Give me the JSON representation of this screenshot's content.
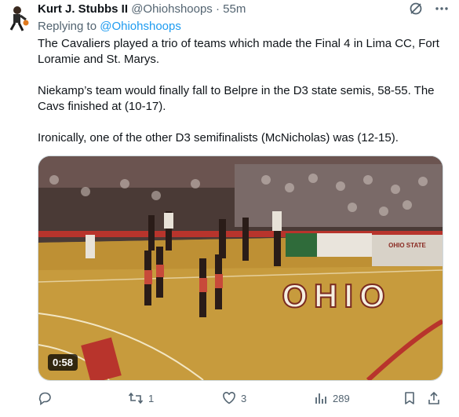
{
  "tweet": {
    "author_name": "Kurt J. Stubbs II",
    "handle": "@Ohiohshoops",
    "separator": "·",
    "time": "55m",
    "reply_prefix": "Replying to",
    "reply_handle": "@Ohiohshoops",
    "paragraphs": [
      "The Cavaliers played a trio of teams which made the Final 4 in Lima CC, Fort Loramie and St. Marys.",
      "Niekamp’s team would finally fall to Belpre in the D3 state semis, 58-55. The Cavs finished at (10-17).",
      "Ironically, one of the other D3 semifinalists (McNicholas) was (12-15)."
    ]
  },
  "media": {
    "duration": "0:58",
    "floor_text": "OHIO",
    "banner_text": "OHIO STATE"
  },
  "actions": {
    "reply_count": "",
    "retweet_count": "1",
    "like_count": "3",
    "views_count": "289"
  },
  "icons": [
    "grok-icon",
    "more-icon",
    "reply-icon",
    "retweet-icon",
    "like-icon",
    "views-icon",
    "bookmark-icon",
    "share-icon"
  ],
  "colors": {
    "link": "#1d9bf0",
    "secondary": "#536471",
    "text": "#0f1419"
  }
}
